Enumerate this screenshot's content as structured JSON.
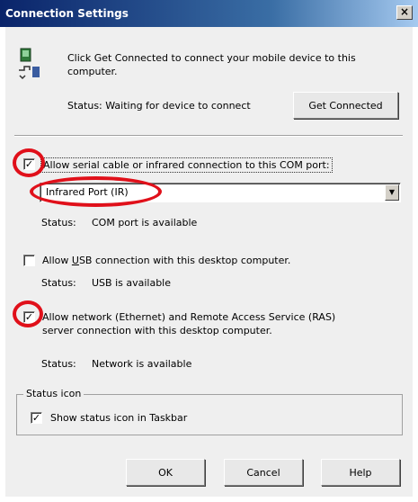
{
  "window": {
    "title": "Connection Settings",
    "close_glyph": "×"
  },
  "intro": {
    "line1": "Click Get Connected to connect your mobile device to this",
    "line2": "computer.",
    "status_text": "Status: Waiting for device to connect",
    "get_connected_label": "Get Connected"
  },
  "serial": {
    "checked": true,
    "label": "Allow serial cable or infrared connection to this COM port:",
    "selected_port": "Infrared Port (IR)",
    "status_label": "Status:",
    "status_value": "COM port is available"
  },
  "usb": {
    "checked": false,
    "label_prefix": "Allow ",
    "label_u": "U",
    "label_suffix": "SB connection with this desktop computer.",
    "status_label": "Status:",
    "status_value": "USB is available"
  },
  "network": {
    "checked": true,
    "line1": "Allow network (Ethernet) and Remote Access Service (RAS)",
    "line2": "server connection with this desktop computer.",
    "status_label": "Status:",
    "status_value": "Network is available"
  },
  "status_icon": {
    "group_label": "Status icon",
    "checked": true,
    "label": "Show status icon in Taskbar"
  },
  "buttons": {
    "ok": "OK",
    "cancel": "Cancel",
    "help": "Help"
  },
  "annotations": {
    "color": "#e0101a"
  },
  "icons": {
    "device": "device-sync-icon",
    "dropdown": "chevron-down-icon"
  }
}
